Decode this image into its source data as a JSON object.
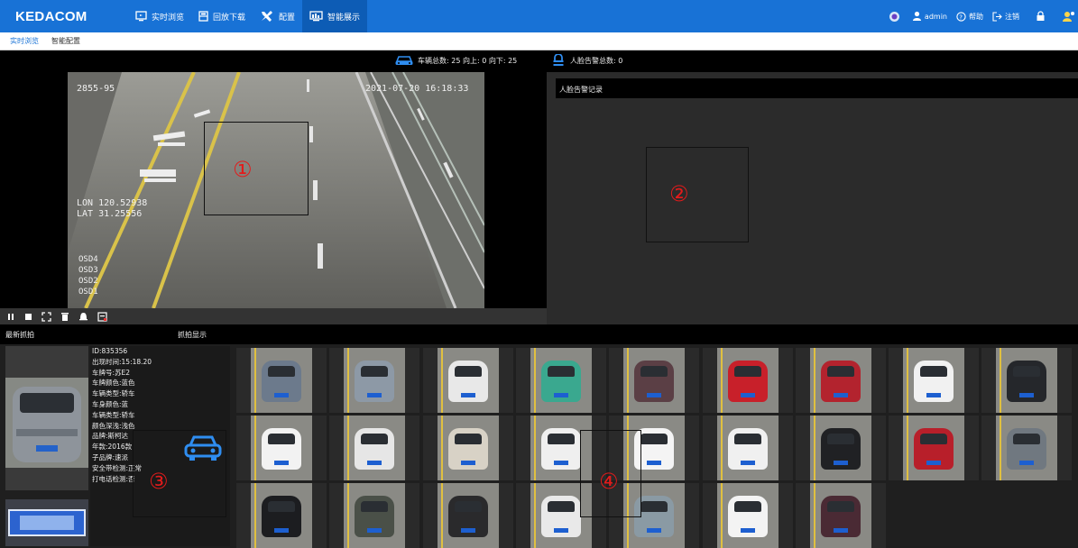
{
  "app": {
    "logo": "KEDACOM"
  },
  "nav": [
    {
      "label": "实时浏览",
      "icon": "monitor-icon",
      "active": false
    },
    {
      "label": "回放下载",
      "icon": "film-icon",
      "active": false
    },
    {
      "label": "配置",
      "icon": "tools-icon",
      "active": false
    },
    {
      "label": "智能展示",
      "icon": "smart-display-icon",
      "active": true
    }
  ],
  "top_right": {
    "user": "admin",
    "help": "帮助",
    "logout": "注销"
  },
  "subtabs": [
    {
      "label": "实时浏览",
      "active": true
    },
    {
      "label": "智能配置",
      "active": false
    }
  ],
  "stats": {
    "vehicle": "车辆总数: 25 向上: 0 向下: 25",
    "face": "人脸告警总数: 0"
  },
  "video": {
    "osd_left": "2855-95",
    "osd_time": "2021-07-20 16:18:33",
    "lon": "LON 120.52938",
    "lat": "LAT 31.25556",
    "osd_lines": [
      "OSD4",
      "OSD3",
      "OSD2",
      "OSD1"
    ]
  },
  "alarm": {
    "header": "人脸告警记录"
  },
  "sections": {
    "latest": "最新抓拍",
    "capture": "抓拍显示"
  },
  "info_lines": [
    "ID:835356",
    "出现时间:15:18.20",
    "车牌号:苏E2",
    "车牌颜色:蓝色",
    "车辆类型:轿车",
    "车身颜色:蓝",
    "车辆类型:轿车",
    "颜色深浅:浅色",
    "品牌:斯柯达",
    "年款:2016款",
    "子品牌:速派",
    "安全带检测:正常",
    "打电话检测:否"
  ],
  "markers": [
    "①",
    "②",
    "③",
    "④"
  ],
  "thumbnails": [
    {
      "color": "#6c7a8c"
    },
    {
      "color": "#8d99a6"
    },
    {
      "color": "#e8e8e8"
    },
    {
      "color": "#3aa88f"
    },
    {
      "color": "#5b3f45"
    },
    {
      "color": "#c8202a"
    },
    {
      "color": "#b3232e"
    },
    {
      "color": "#f1f1f1"
    },
    {
      "color": "#25272b"
    },
    {
      "color": "#f2f2f2"
    },
    {
      "color": "#e6e6e6"
    },
    {
      "color": "#d8d2c6"
    },
    {
      "color": "#efefef"
    },
    {
      "color": "#f4f4f4"
    },
    {
      "color": "#f0f0f0"
    },
    {
      "color": "#202124"
    },
    {
      "color": "#b81f2a"
    },
    {
      "color": "#707880"
    },
    {
      "color": "#1c1d20"
    },
    {
      "color": "#4a5048"
    },
    {
      "color": "#2a2a2c"
    },
    {
      "color": "#e9e9e9"
    },
    {
      "color": "#8a9aa4"
    },
    {
      "color": "#f3f3f3"
    },
    {
      "color": "#4a2a34"
    }
  ]
}
